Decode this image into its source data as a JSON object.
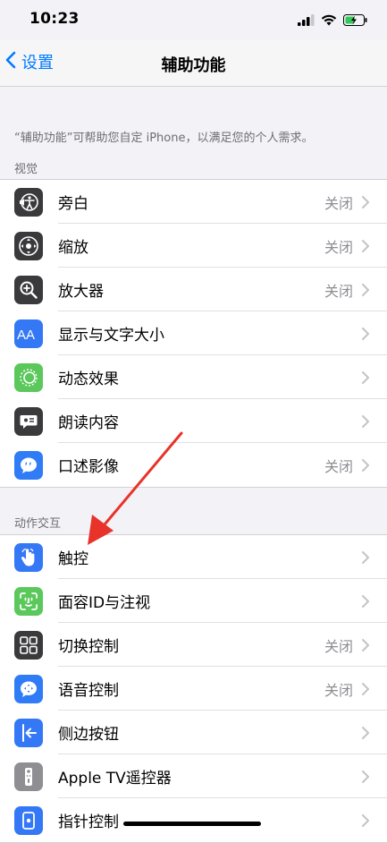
{
  "status": {
    "time": "10:23"
  },
  "nav": {
    "back_label": "设置",
    "title": "辅助功能"
  },
  "intro": "“辅助功能”可帮助您自定 iPhone，以满足您的个人需求。",
  "sections": [
    {
      "header": "视觉",
      "items": [
        {
          "label": "旁白",
          "value": "关闭",
          "icon": "voiceover-icon",
          "color": "#3a3a3c"
        },
        {
          "label": "缩放",
          "value": "关闭",
          "icon": "zoom-icon",
          "color": "#3a3a3c"
        },
        {
          "label": "放大器",
          "value": "关闭",
          "icon": "magnifier-icon",
          "color": "#3a3a3c"
        },
        {
          "label": "显示与文字大小",
          "value": "",
          "icon": "text-size-icon",
          "color": "#3478f6"
        },
        {
          "label": "动态效果",
          "value": "",
          "icon": "motion-icon",
          "color": "#5ac85a"
        },
        {
          "label": "朗读内容",
          "value": "",
          "icon": "spoken-content-icon",
          "color": "#3a3a3c"
        },
        {
          "label": "口述影像",
          "value": "关闭",
          "icon": "audio-description-icon",
          "color": "#2f7cf6"
        }
      ]
    },
    {
      "header": "动作交互",
      "items": [
        {
          "label": "触控",
          "value": "",
          "icon": "touch-icon",
          "color": "#3478f6"
        },
        {
          "label": "面容ID与注视",
          "value": "",
          "icon": "face-id-icon",
          "color": "#5ac85a"
        },
        {
          "label": "切换控制",
          "value": "关闭",
          "icon": "switch-control-icon",
          "color": "#3a3a3c"
        },
        {
          "label": "语音控制",
          "value": "关闭",
          "icon": "voice-control-icon",
          "color": "#2f7cf6"
        },
        {
          "label": "侧边按钮",
          "value": "",
          "icon": "side-button-icon",
          "color": "#3478f6"
        },
        {
          "label": "Apple TV遥控器",
          "value": "",
          "icon": "apple-tv-remote-icon",
          "color": "#8e8e93"
        },
        {
          "label": "指针控制",
          "value": "",
          "icon": "pointer-control-icon",
          "color": "#3478f6"
        }
      ]
    }
  ],
  "colors": {
    "accent": "#007aff",
    "arrow": "#e8332a",
    "battery": "#34c759"
  }
}
